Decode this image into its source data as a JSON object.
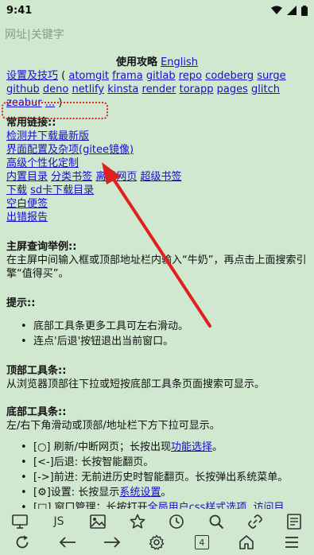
{
  "status_bar": {
    "time": "9:41"
  },
  "url_bar": {
    "placeholder": "网址|关键字"
  },
  "content": {
    "guide_title": "使用攻略",
    "english_link": "English",
    "settings_link": "设置及技巧",
    "open_paren": " ( ",
    "mirrors": [
      "atomgit",
      "frama",
      "gitlab",
      "repo",
      "codeberg",
      "surge",
      "github",
      "deno",
      "netlify",
      "kinsta",
      "render",
      "torapp",
      "pages",
      "glitch",
      "zeabur",
      "..."
    ],
    "close_paren": " )",
    "common_links_heading": "常用链接::",
    "link_check_update": "检测并下载最新版",
    "link_ui_config": "界面配置及杂项(gitee镜像)",
    "link_advanced": "高级个性化定制",
    "link_builtin": "内置目录",
    "link_category": "分类书签",
    "link_offline": "离线网页",
    "link_super_bookmarks": "超级书签",
    "link_download": "下载",
    "link_sd_download": "sd卡下载目录",
    "link_blank_note": "空白便签",
    "link_error_report": "出错报告",
    "home_query_heading": "主屏查询举例::",
    "home_query_text": "在主屏中间输入框或顶部地址栏内输入“牛奶”，再点击上面搜索引擎“值得买”。",
    "tips_heading": "提示::",
    "tips": [
      "底部工具条更多工具可左右滑动。",
      "连点'后退'按钮退出当前窗口。"
    ],
    "top_toolbar_heading": "顶部工具条::",
    "top_toolbar_text": "从浏览器顶部往下拉或短按底部工具条页面搜索可显示。",
    "bottom_toolbar_heading": "底部工具条::",
    "bottom_toolbar_text": "左/右下角滑动或顶部/地址栏下方下拉可显示。",
    "bottom_items": [
      {
        "prefix": "[○] 刷新/中断网页；长按出现",
        "link": "功能选择",
        "suffix": "。"
      },
      {
        "prefix": "[<-]后退: 长按智能翻页。",
        "link": "",
        "suffix": ""
      },
      {
        "prefix": "[->]前进: 无前进历史时智能翻页。长按弹出系统菜单。",
        "link": "",
        "suffix": ""
      },
      {
        "prefix": "[⚙]设置: 长按显示",
        "link": "系统设置",
        "suffix": "。"
      },
      {
        "prefix": "[□] 窗口管理；长按打开",
        "link": "全局用户css样式选项",
        "link2": "访问目",
        "suffix": ", "
      }
    ]
  },
  "toolbar1": {
    "js_label": "JS"
  },
  "toolbar2": {
    "tab_count": "4"
  },
  "colors": {
    "background": "#cfe8cf",
    "link": "#1a0dcc",
    "annotation": "#e02020"
  }
}
